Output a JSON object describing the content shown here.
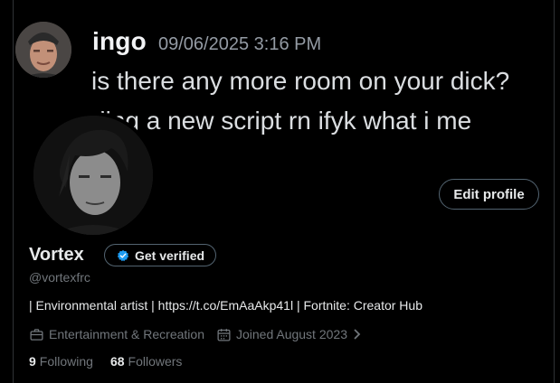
{
  "banner": {
    "author": "ingo",
    "timestamp": "09/06/2025 3:16 PM",
    "message_line1": "is there any more room on your dick?",
    "message_line2": "ding a new script rn ifyk what i me"
  },
  "profile": {
    "display_name": "Vortex",
    "get_verified_label": "Get verified",
    "handle": "@vortexfrc",
    "bio": "| Environmental artist | https://t.co/EmAaAkp41l | Fortnite: Creator Hub",
    "category": "Entertainment & Recreation",
    "joined": "Joined August 2023",
    "following_count": "9",
    "following_label": "Following",
    "followers_count": "68",
    "followers_label": "Followers",
    "edit_profile_label": "Edit profile"
  },
  "icons": {
    "verified_badge": "verified-badge-icon",
    "category": "briefcase-icon",
    "joined": "calendar-icon",
    "chevron": "chevron-right-icon"
  },
  "colors": {
    "background": "#000000",
    "text_primary": "#e7e9ea",
    "text_secondary": "#71767b",
    "border": "#536471",
    "verified_blue": "#1d9bf0"
  }
}
